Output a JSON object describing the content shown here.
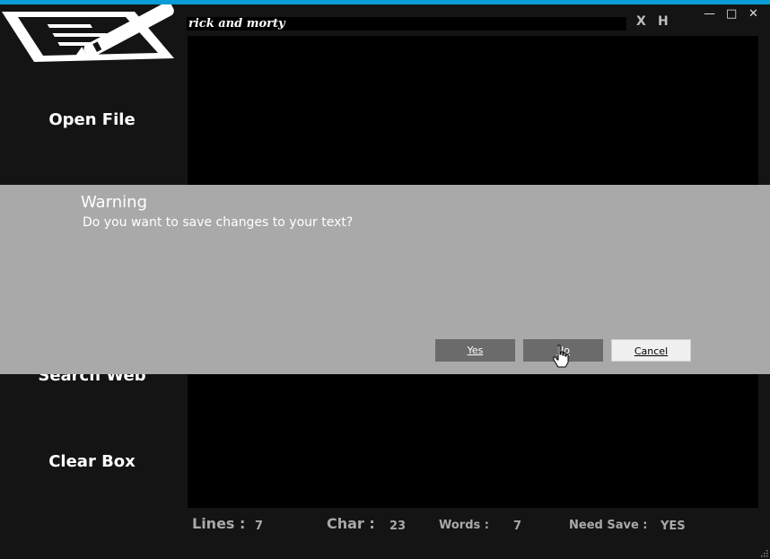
{
  "window": {
    "title_input_value": "rick and morty",
    "x_button": "X",
    "h_button": "H",
    "minimize_glyph": "—",
    "maximize_glyph": "□",
    "close_glyph": "✕"
  },
  "sidebar": {
    "open_file": "Open File",
    "search_web": "Search Web",
    "clear_box": "Clear Box"
  },
  "dialog": {
    "title": "Warning",
    "message": "Do you want to save changes to your text?",
    "yes": "Yes",
    "no": "No",
    "cancel": "Cancel"
  },
  "status": {
    "lines_label": "Lines :",
    "lines_value": "7",
    "char_label": "Char :",
    "char_value": "23",
    "words_label": "Words :",
    "words_value": "7",
    "needsave_label": "Need Save :",
    "needsave_value": "YES"
  },
  "colors": {
    "accent": "#0b9bd6",
    "background": "#141414",
    "dialog": "#a9a9a9"
  },
  "icons": [
    "notepad-pencil-logo-icon",
    "hand-pointer-cursor-icon",
    "resize-grip-icon"
  ]
}
